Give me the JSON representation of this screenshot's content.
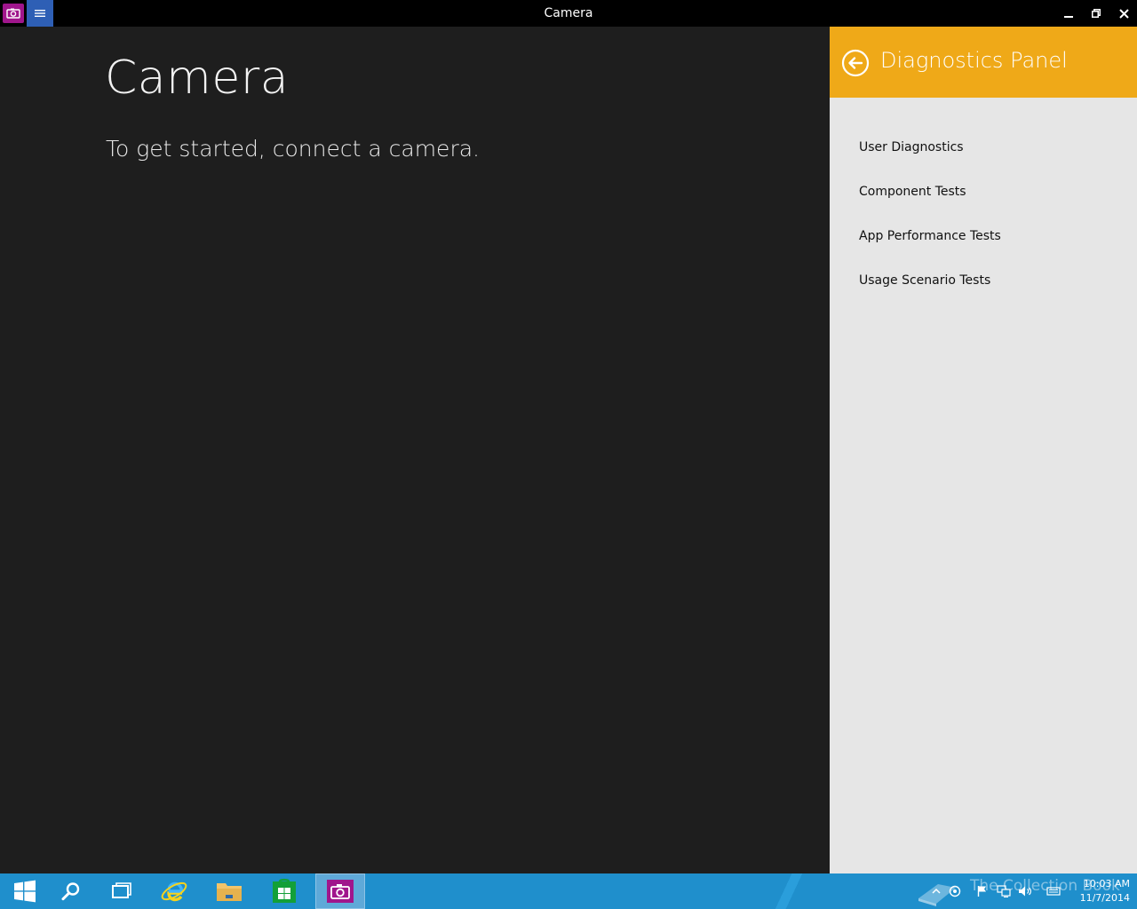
{
  "window": {
    "title": "Camera"
  },
  "main": {
    "title": "Camera",
    "subtitle": "To get started, connect a camera."
  },
  "panel": {
    "title": "Diagnostics Panel",
    "items": [
      {
        "label": "User Diagnostics"
      },
      {
        "label": "Component Tests"
      },
      {
        "label": "App Performance Tests"
      },
      {
        "label": "Usage Scenario Tests"
      }
    ]
  },
  "taskbar": {
    "apps": [
      {
        "icon": "start-windows-icon"
      },
      {
        "icon": "search-icon"
      },
      {
        "icon": "task-view-icon"
      },
      {
        "icon": "internet-explorer-icon"
      },
      {
        "icon": "file-explorer-icon"
      },
      {
        "icon": "store-icon"
      },
      {
        "icon": "camera-icon",
        "active": true
      }
    ],
    "tray": {
      "watermark": "The Collection Book",
      "time": "10:03 AM",
      "date": "11/7/2014"
    }
  },
  "colors": {
    "panel_header": "#efa918",
    "app_icon": "#a0168c",
    "menu_button": "#2e5fb5",
    "taskbar": "#1f8fcc",
    "main_bg": "#1e1e1e",
    "panel_bg": "#e6e6e6"
  }
}
